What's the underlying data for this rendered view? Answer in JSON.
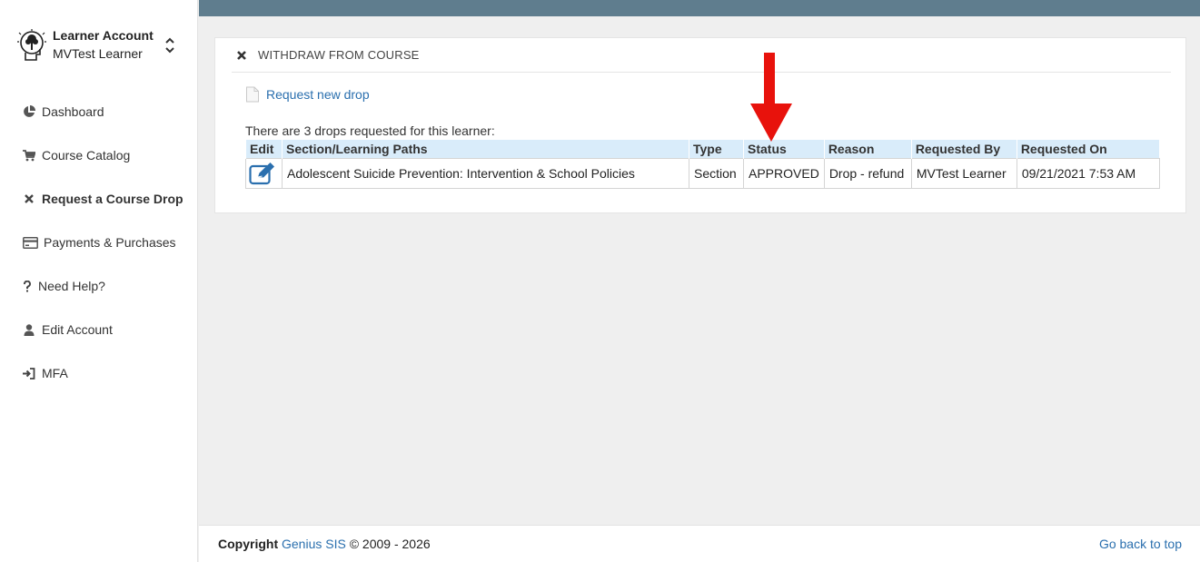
{
  "account": {
    "title": "Learner Account",
    "name": "MVTest Learner",
    "logo_icon": "head-tree-logo-icon",
    "toggle_icon": "chevron-up-down-icon"
  },
  "sidebar": {
    "items": [
      {
        "label": "Dashboard",
        "icon": "pie-chart-icon"
      },
      {
        "label": "Course Catalog",
        "icon": "shopping-cart-icon"
      },
      {
        "label": "Request a Course Drop",
        "icon": "close-icon",
        "active": true
      },
      {
        "label": "Payments & Purchases",
        "icon": "credit-card-icon"
      },
      {
        "label": "Need Help?",
        "icon": "question-icon"
      },
      {
        "label": "Edit Account",
        "icon": "user-icon"
      },
      {
        "label": "MFA",
        "icon": "sign-in-icon"
      }
    ]
  },
  "panel": {
    "title": "WITHDRAW FROM COURSE",
    "request_link": "Request new drop",
    "summary": "There are 3 drops requested for this learner:",
    "table": {
      "headers": [
        "Edit",
        "Section/Learning Paths",
        "Type",
        "Status",
        "Reason",
        "Requested By",
        "Requested On"
      ],
      "rows": [
        {
          "section": "Adolescent Suicide Prevention: Intervention & School Policies",
          "type": "Section",
          "status": "APPROVED",
          "reason": "Drop - refund",
          "requested_by": "MVTest Learner",
          "requested_on": "09/21/2021 7:53 AM"
        }
      ]
    }
  },
  "colors": {
    "topbar": "#5f7d8e",
    "link": "#2a6fae",
    "table_header": "#d9ecfa",
    "annotation_arrow": "#e8120c"
  },
  "footer": {
    "copyright_label": "Copyright",
    "brand": "Genius SIS",
    "years": "© 2009 - 2026",
    "back_to_top": "Go back to top"
  }
}
